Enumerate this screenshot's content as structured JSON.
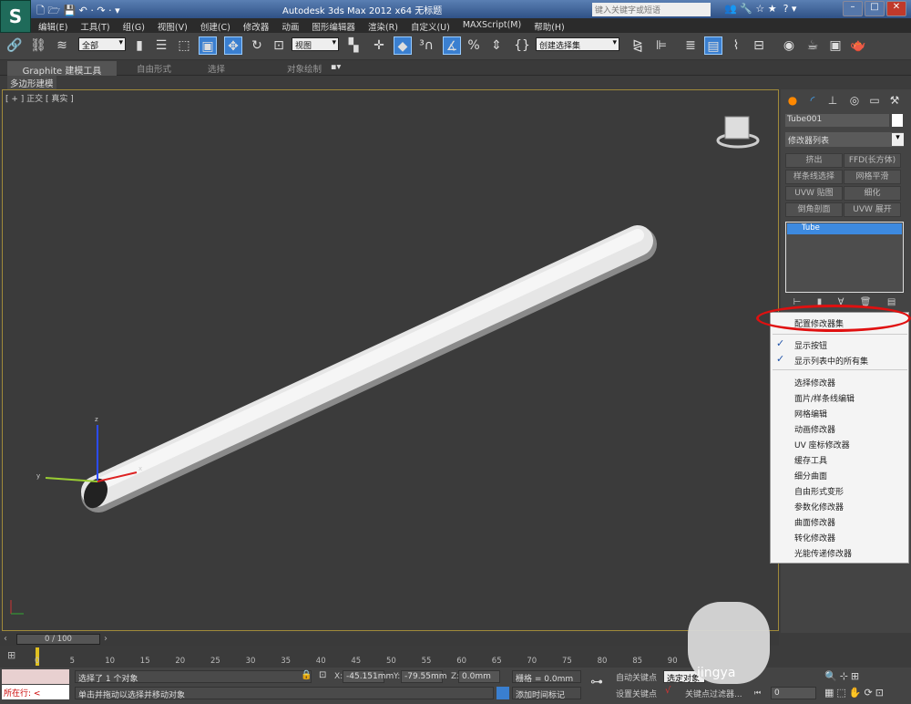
{
  "title_bar": {
    "title": "Autodesk 3ds Max  2012 x64     无标题",
    "search_placeholder": "键入关键字或短语"
  },
  "menu": [
    "编辑(E)",
    "工具(T)",
    "组(G)",
    "视图(V)",
    "创建(C)",
    "修改器",
    "动画",
    "图形编辑器",
    "渲染(R)",
    "自定义(U)",
    "MAXScript(M)",
    "帮助(H)"
  ],
  "toolbar": {
    "selection_filter": "全部",
    "ref_coord": "视图",
    "named_selection": "创建选择集"
  },
  "ribbon": {
    "tabs": [
      "Graphite 建模工具",
      "自由形式",
      "选择",
      "对象绘制"
    ],
    "subtab": "多边形建模"
  },
  "viewport": {
    "label": "[ + ] 正交 [ 真实 ]"
  },
  "command_panel": {
    "object_name": "Tube001",
    "modifier_list": "修改器列表",
    "buttons": [
      "挤出",
      "FFD(长方体)",
      "样条线选择",
      "网格平滑",
      "UVW 贴图",
      "细化",
      "倒角剖面",
      "UVW 展开"
    ],
    "stack_item": "Tube"
  },
  "context_menu": {
    "items": [
      {
        "label": "配置修改器集",
        "checked": false
      },
      {
        "label": "显示按钮",
        "checked": true
      },
      {
        "label": "显示列表中的所有集",
        "checked": true
      },
      {
        "label": "选择修改器"
      },
      {
        "label": "面片/样条线编辑"
      },
      {
        "label": "网格编辑"
      },
      {
        "label": "动画修改器"
      },
      {
        "label": "UV 座标修改器"
      },
      {
        "label": "缓存工具"
      },
      {
        "label": "细分曲面"
      },
      {
        "label": "自由形式变形"
      },
      {
        "label": "参数化修改器"
      },
      {
        "label": "曲面修改器"
      },
      {
        "label": "转化修改器"
      },
      {
        "label": "光能传递修改器"
      }
    ]
  },
  "timeline": {
    "frame": "0 / 100",
    "ticks": [
      "0",
      "5",
      "10",
      "15",
      "20",
      "25",
      "30",
      "35",
      "40",
      "45",
      "50",
      "55",
      "60",
      "65",
      "70",
      "75",
      "80",
      "85",
      "90"
    ]
  },
  "status": {
    "selection": "选择了 1 个对象",
    "prompt": "单击并拖动以选择并移动对象",
    "x": "-45.151mm",
    "y": "-79.55mm",
    "z": "0.0mm",
    "grid": "栅格 = 0.0mm",
    "add_time_tag": "添加时间标记",
    "auto_key": "自动关键点",
    "selected_object": "选定对象",
    "set_key": "设置关键点",
    "key_filters": "关键点过滤器...",
    "current_frame": "0",
    "maxscript": "所在行: <",
    "watermark": "jingya"
  },
  "colors": {
    "accent": "#3d8ae0",
    "highlight_circle": "#e01010"
  }
}
